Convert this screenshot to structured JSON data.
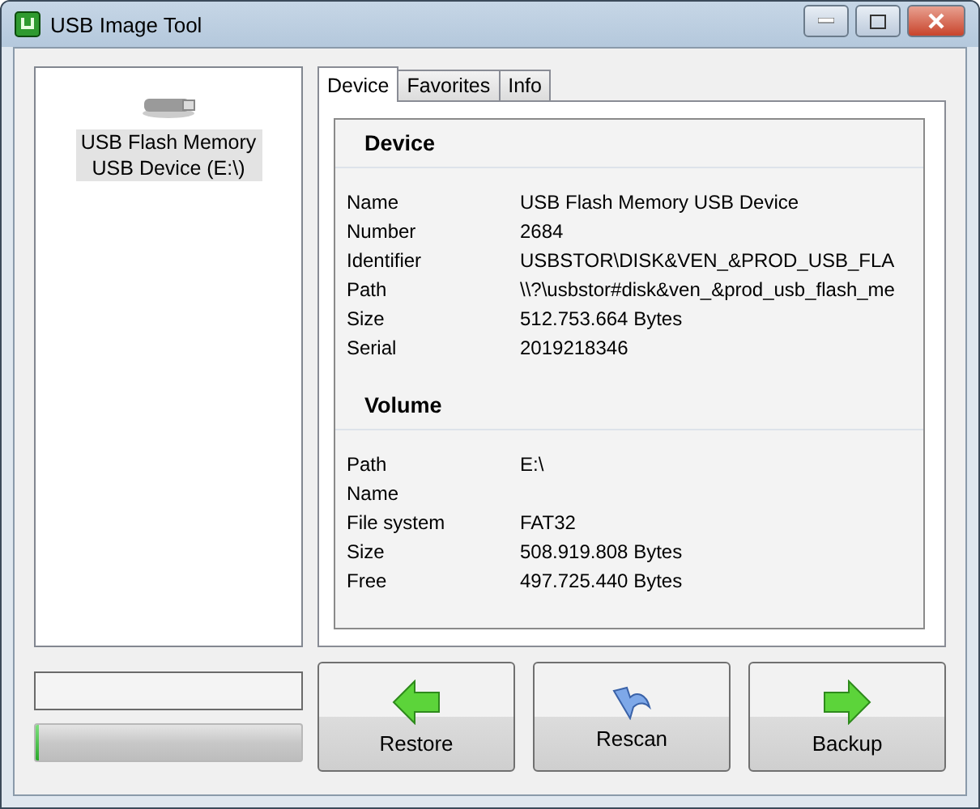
{
  "window": {
    "title": "USB Image Tool"
  },
  "devices": [
    {
      "label": "USB Flash Memory USB Device (E:\\)",
      "selected": true
    }
  ],
  "tabs": [
    {
      "label": "Device",
      "selected": true
    },
    {
      "label": "Favorites",
      "selected": false
    },
    {
      "label": "Info",
      "selected": false
    }
  ],
  "sections": [
    {
      "title": "Device",
      "rows": [
        {
          "label": "Name",
          "value": "USB Flash Memory USB Device"
        },
        {
          "label": "Number",
          "value": "2684"
        },
        {
          "label": "Identifier",
          "value": "USBSTOR\\DISK&VEN_&PROD_USB_FLA"
        },
        {
          "label": "Path",
          "value": "\\\\?\\usbstor#disk&ven_&prod_usb_flash_me"
        },
        {
          "label": "Size",
          "value": "512.753.664 Bytes"
        },
        {
          "label": "Serial",
          "value": "2019218346"
        }
      ]
    },
    {
      "title": "Volume",
      "rows": [
        {
          "label": "Path",
          "value": "E:\\"
        },
        {
          "label": "Name"
        },
        {
          "label": "File system",
          "value": "FAT32"
        },
        {
          "label": "Size",
          "value": "508.919.808 Bytes"
        },
        {
          "label": "Free",
          "value": "497.725.440 Bytes"
        }
      ]
    }
  ],
  "progress": {
    "level": 0.01
  },
  "buttons": [
    {
      "label": "Restore",
      "kind": "restore"
    },
    {
      "label": "Rescan",
      "kind": "rescan"
    },
    {
      "label": "Backup",
      "kind": "backup"
    }
  ]
}
